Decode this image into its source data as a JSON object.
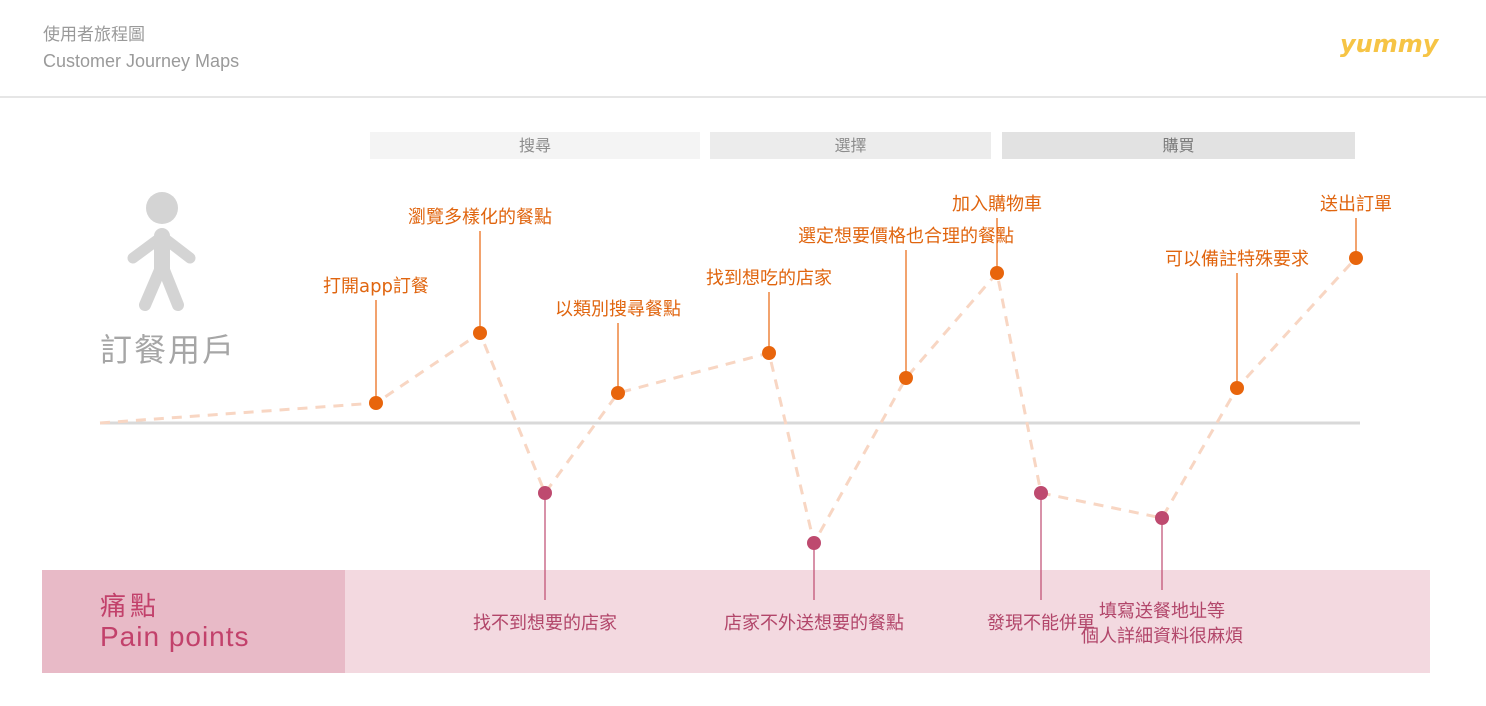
{
  "header": {
    "title_zh": "使用者旅程圖",
    "title_en": "Customer Journey Maps",
    "logo": "yummy"
  },
  "phases": [
    "搜尋",
    "選擇",
    "購買"
  ],
  "persona": {
    "label": "訂餐用戶",
    "icon": "person-icon"
  },
  "pain_points": {
    "title_zh": "痛點",
    "title_en": "Pain points"
  },
  "colors": {
    "positive": "#e8650c",
    "negative": "#be4a6f",
    "path": "#f8d6c3",
    "baseline": "#d9d9d9",
    "pain_band": "#f3d9e0",
    "pain_header": "#e8bac7",
    "logo": "#f6c445"
  },
  "chart_data": {
    "type": "line",
    "title": "",
    "xlabel": "",
    "ylabel": "",
    "steps": [
      {
        "label": "",
        "sentiment": "neutral",
        "score": 0
      },
      {
        "label": "打開app訂餐",
        "sentiment": "positive",
        "score": 0.2
      },
      {
        "label": "瀏覽多樣化的餐點",
        "sentiment": "positive",
        "score": 0.9
      },
      {
        "label": "找不到想要的店家",
        "sentiment": "negative",
        "score": -0.7
      },
      {
        "label": "以類別搜尋餐點",
        "sentiment": "positive",
        "score": 0.3
      },
      {
        "label": "找到想吃的店家",
        "sentiment": "positive",
        "score": 0.7
      },
      {
        "label": "店家不外送想要的餐點",
        "sentiment": "negative",
        "score": -1.2
      },
      {
        "label": "選定想要價格也合理的餐點",
        "sentiment": "positive",
        "score": 0.45
      },
      {
        "label": "加入購物車",
        "sentiment": "positive",
        "score": 1.5
      },
      {
        "label": "發現不能併單",
        "sentiment": "negative",
        "score": -0.7
      },
      {
        "label": "填寫送餐地址等\n個人詳細資料很麻煩",
        "sentiment": "negative",
        "score": -0.95
      },
      {
        "label": "可以備註特殊要求",
        "sentiment": "positive",
        "score": 0.35
      },
      {
        "label": "送出訂單",
        "sentiment": "positive",
        "score": 1.65
      }
    ]
  }
}
